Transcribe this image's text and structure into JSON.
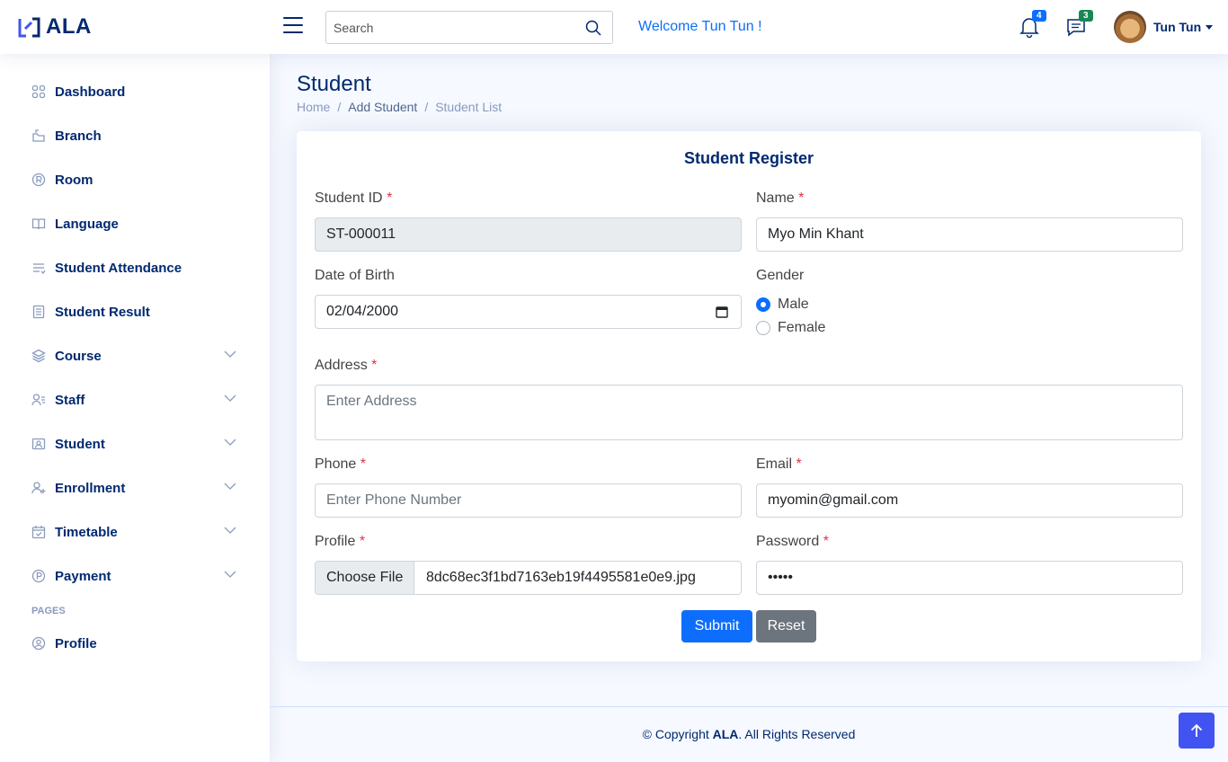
{
  "header": {
    "logo_text": "ALA",
    "search_placeholder": "Search",
    "welcome": "Welcome Tun Tun !",
    "notifications_count": "4",
    "messages_count": "3",
    "user_name": "Tun Tun"
  },
  "sidebar": {
    "items": [
      {
        "label": "Dashboard",
        "icon": "grid-icon"
      },
      {
        "label": "Branch",
        "icon": "branch-icon"
      },
      {
        "label": "Room",
        "icon": "registered-icon"
      },
      {
        "label": "Language",
        "icon": "book-icon"
      },
      {
        "label": "Student Attendance",
        "icon": "list-icon"
      },
      {
        "label": "Student Result",
        "icon": "document-icon"
      },
      {
        "label": "Course",
        "icon": "layers-icon",
        "expandable": true
      },
      {
        "label": "Staff",
        "icon": "person-lines-icon",
        "expandable": true
      },
      {
        "label": "Student",
        "icon": "person-badge-icon",
        "expandable": true
      },
      {
        "label": "Enrollment",
        "icon": "person-plus-icon",
        "expandable": true
      },
      {
        "label": "Timetable",
        "icon": "calendar-check-icon",
        "expandable": true
      },
      {
        "label": "Payment",
        "icon": "payment-icon",
        "expandable": true
      }
    ],
    "pages_heading": "PAGES",
    "profile_label": "Profile"
  },
  "main": {
    "title": "Student",
    "breadcrumb": [
      "Home",
      "Add Student",
      "Student List"
    ]
  },
  "form": {
    "title": "Student Register",
    "student_id_label": "Student ID",
    "student_id_value": "ST-000011",
    "name_label": "Name",
    "name_value": "Myo Min Khant",
    "dob_label": "Date of Birth",
    "dob_value": "02/04/2000",
    "gender_label": "Gender",
    "gender_options": [
      "Male",
      "Female"
    ],
    "gender_selected": "Male",
    "address_label": "Address",
    "address_placeholder": "Enter Address",
    "phone_label": "Phone",
    "phone_placeholder": "Enter Phone Number",
    "email_label": "Email",
    "email_value": "myomin@gmail.com",
    "profile_label": "Profile",
    "file_button": "Choose File",
    "file_name": "8dc68ec3f1bd7163eb19f4495581e0e9.jpg",
    "password_label": "Password",
    "password_value": "•••••",
    "required_mark": "*",
    "submit_label": "Submit",
    "reset_label": "Reset"
  },
  "footer": {
    "prefix": "© Copyright",
    "brand": "ALA",
    "suffix": ". All Rights Reserved"
  },
  "colors": {
    "brand": "#012970",
    "primary": "#0d6efd",
    "secondary": "#6c757d",
    "required": "#dc3545"
  }
}
